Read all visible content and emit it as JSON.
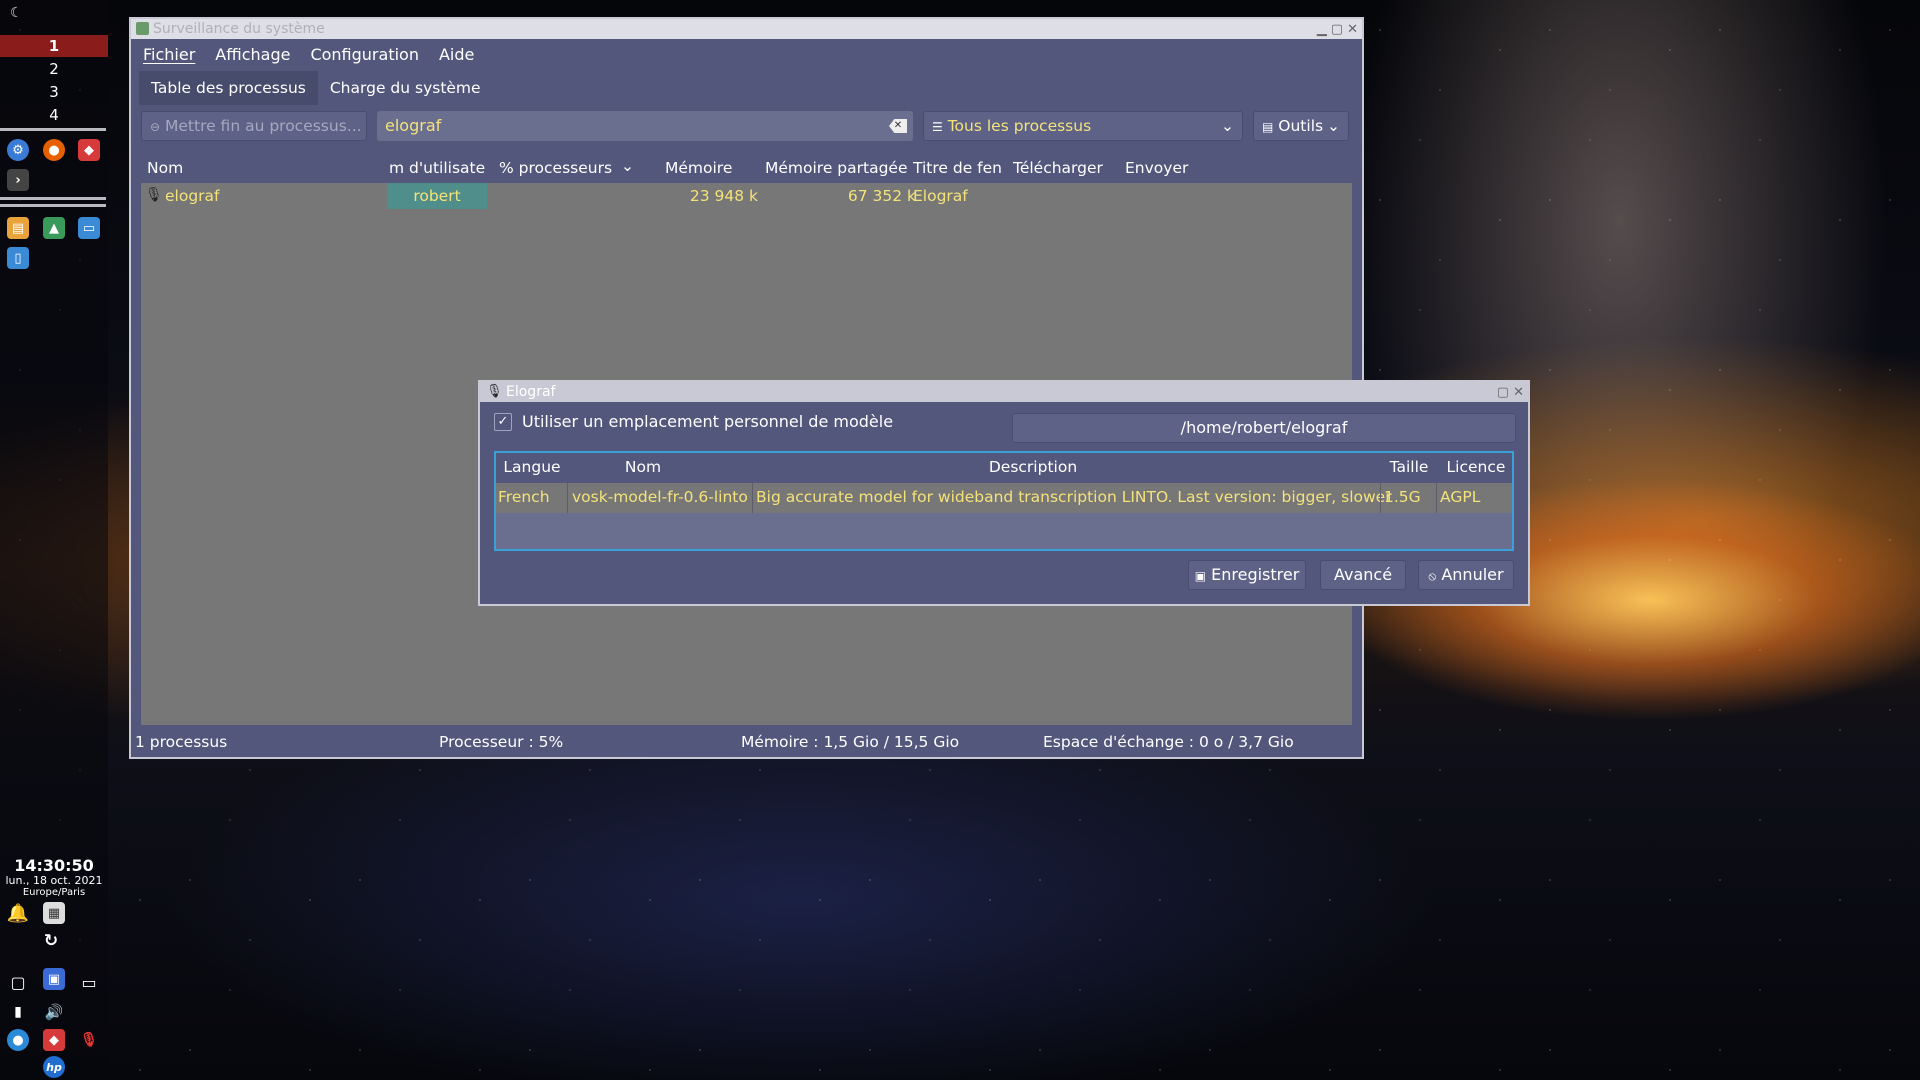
{
  "panel": {
    "desktops": [
      "1",
      "2",
      "3",
      "4"
    ],
    "active_desktop": "1",
    "clock": {
      "time": "14:30:50",
      "date": "lun., 18 oct. 2021",
      "timezone": "Europe/Paris"
    }
  },
  "sysmon": {
    "title": "Surveillance du système",
    "menu": [
      "Fichier",
      "Affichage",
      "Configuration",
      "Aide"
    ],
    "tabs": [
      "Table des processus",
      "Charge du système"
    ],
    "toolbar": {
      "kill_button": "Mettre fin au processus...",
      "search_value": "elograf",
      "filter_value": "Tous les processus",
      "tools_button": "Outils"
    },
    "columns": [
      "Nom",
      "m d'utilisate",
      "% processeurs",
      "Mémoire",
      "Mémoire partagée",
      "Titre de fen",
      "Télécharger",
      "Envoyer"
    ],
    "rows": [
      {
        "name": "elograf",
        "user": "robert",
        "cpu": "",
        "memory": "23 948 k",
        "shared": "67 352 k",
        "window_title": "Elograf",
        "download": "",
        "upload": ""
      }
    ],
    "status": {
      "processes": "1 processus",
      "cpu": "Processeur : 5%",
      "memory": "Mémoire : 1,5 Gio / 15,5 Gio",
      "swap": "Espace d'échange : 0 o / 3,7 Gio"
    }
  },
  "elograf": {
    "title": "Elograf",
    "checkbox_label": "Utiliser un emplacement personnel de modèle",
    "checkbox_checked": true,
    "path": "/home/robert/elograf",
    "columns": [
      "Langue",
      "Nom",
      "Description",
      "Taille",
      "Licence"
    ],
    "rows": [
      {
        "language": "French",
        "name": "vosk-model-fr-0.6-linto",
        "description": "Big accurate model for wideband transcription LINTO. Last version: bigger, slower",
        "size": "1.5G",
        "license": "AGPL"
      }
    ],
    "buttons": {
      "save": "Enregistrer",
      "advanced": "Avancé",
      "cancel": "Annuler"
    }
  },
  "colors": {
    "window_bg": "#53577c",
    "list_bg": "#777777",
    "highlight_text": "#f4e27a",
    "active_desktop": "#8a1c1c",
    "user_cell": "#4f8e8a",
    "focus_border": "#3aa0d8"
  }
}
